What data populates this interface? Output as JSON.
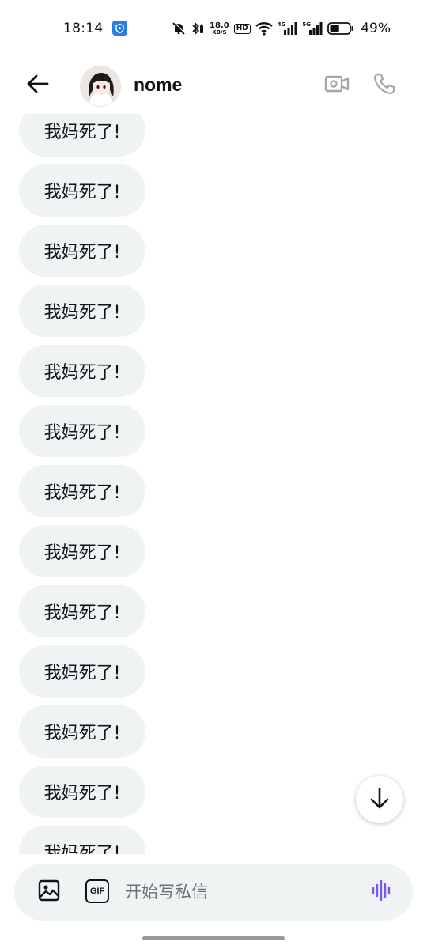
{
  "status_bar": {
    "time": "18:14",
    "net_speed_value": "18.0",
    "net_speed_unit": "KB/S",
    "hd_label": "HD",
    "net1_label": "4G",
    "net2_label": "5G",
    "battery_percent": "49%",
    "battery_level": 0.49
  },
  "header": {
    "name": "nome",
    "back_icon": "arrow-left-icon",
    "video_icon": "video-call-icon",
    "call_icon": "phone-icon",
    "icon_color": "#a3a8ad"
  },
  "messages": [
    {
      "text": "我妈死了!"
    },
    {
      "text": "我妈死了!"
    },
    {
      "text": "我妈死了!"
    },
    {
      "text": "我妈死了!"
    },
    {
      "text": "我妈死了!"
    },
    {
      "text": "我妈死了!"
    },
    {
      "text": "我妈死了!"
    },
    {
      "text": "我妈死了!"
    },
    {
      "text": "我妈死了!"
    },
    {
      "text": "我妈死了!"
    },
    {
      "text": "我妈死了!"
    },
    {
      "text": "我妈死了!"
    },
    {
      "text": "我妈死了!"
    }
  ],
  "composer": {
    "placeholder": "开始写私信",
    "gif_label": "GIF",
    "image_icon": "image-icon",
    "voice_icon": "voice-wave-icon",
    "voice_color": "#7856ff"
  },
  "colors": {
    "bubble_bg": "#eff3f4",
    "text": "#0f1419"
  }
}
